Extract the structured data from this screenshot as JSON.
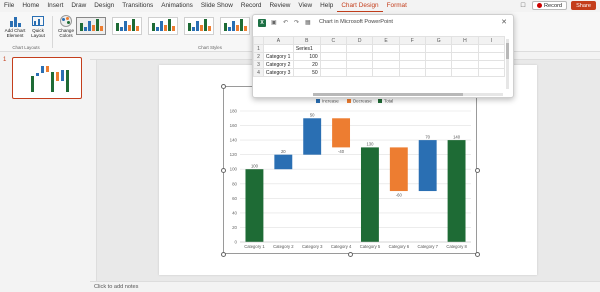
{
  "ribbon_tabs": [
    "File",
    "Home",
    "Insert",
    "Draw",
    "Design",
    "Transitions",
    "Animations",
    "Slide Show",
    "Record",
    "Review",
    "View",
    "Help",
    "Chart Design",
    "Format"
  ],
  "active_tab": "Chart Design",
  "record_label": "Record",
  "share_label": "Share",
  "ribbon": {
    "add_chart_element": "Add Chart Element",
    "quick_layout": "Quick Layout",
    "change_colors": "Change Colors",
    "chart_layouts_label": "Chart Layouts",
    "chart_styles_label": "Chart Styles"
  },
  "slide_number": "1",
  "notes_placeholder": "Click to add notes",
  "excel": {
    "title": "Chart in Microsoft PowerPoint",
    "col_headers": [
      "",
      "A",
      "B",
      "C",
      "D",
      "E",
      "F",
      "G",
      "H",
      "I"
    ],
    "rows": [
      {
        "num": "1",
        "a": "",
        "b": "Series1"
      },
      {
        "num": "2",
        "a": "Category 1",
        "b": "100"
      },
      {
        "num": "3",
        "a": "Category 2",
        "b": "20"
      },
      {
        "num": "4",
        "a": "Category 3",
        "b": "50"
      }
    ]
  },
  "colors": {
    "increase": "#2a6fb3",
    "decrease": "#ed7d31",
    "total": "#1e6b35",
    "accent": "#c43e1c"
  },
  "chart_data": {
    "type": "bar",
    "subtype": "waterfall",
    "legend": [
      "Increase",
      "Decrease",
      "Total"
    ],
    "legend_position": "top",
    "categories": [
      "Category 1",
      "Category 2",
      "Category 3",
      "Category 4",
      "Category 5",
      "Category 6",
      "Category 7",
      "Category 8"
    ],
    "values": [
      100,
      20,
      50,
      -40,
      130,
      -60,
      70,
      140
    ],
    "kinds": [
      "total",
      "increase",
      "increase",
      "decrease",
      "total",
      "decrease",
      "increase",
      "total"
    ],
    "data_labels": [
      "100",
      "20",
      "50",
      "-40",
      "130",
      "-60",
      "70",
      "140"
    ],
    "yticks": [
      0,
      20,
      40,
      60,
      80,
      100,
      120,
      140,
      160,
      180
    ],
    "ylim": [
      0,
      180
    ],
    "grid": true
  }
}
